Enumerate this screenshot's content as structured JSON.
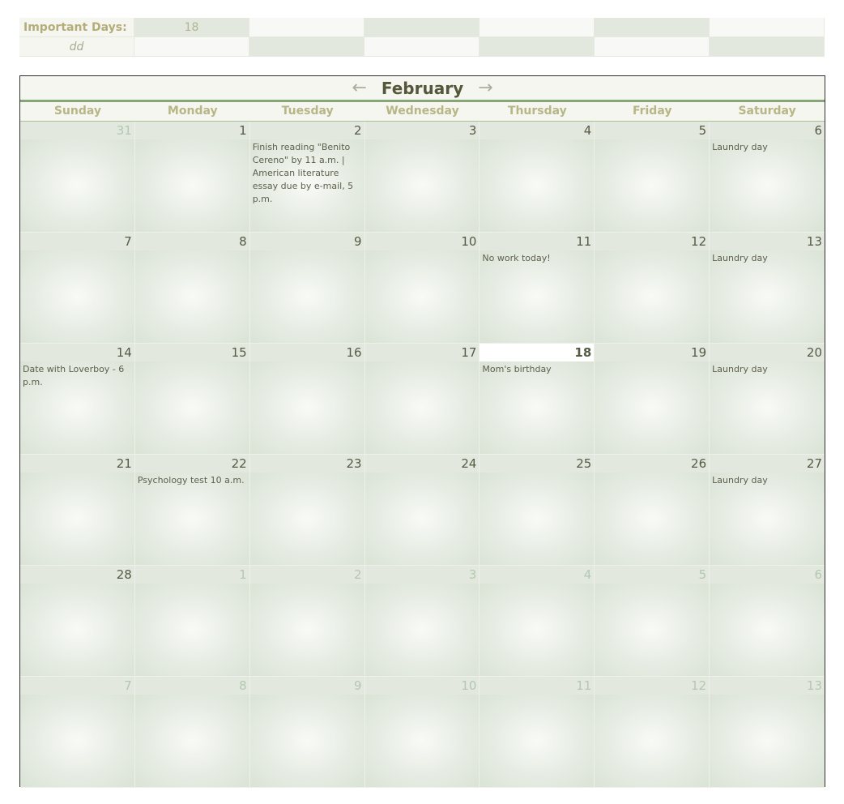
{
  "important_days": {
    "label": "Important Days:",
    "sub_label": "dd",
    "days": [
      "18",
      "",
      "",
      "",
      "",
      ""
    ]
  },
  "calendar": {
    "month": "February",
    "prev_icon": "left-arrow-icon",
    "next_icon": "right-arrow-icon",
    "prev_symbol": "←",
    "next_symbol": "→",
    "weekdays": [
      "Sunday",
      "Monday",
      "Tuesday",
      "Wednesday",
      "Thursday",
      "Friday",
      "Saturday"
    ],
    "cells": [
      {
        "day": "31",
        "other": true,
        "note": ""
      },
      {
        "day": "1",
        "note": ""
      },
      {
        "day": "2",
        "note": "Finish reading \"Benito Cereno\" by 11 a.m. | American literature essay due by e-mail, 5 p.m."
      },
      {
        "day": "3",
        "note": ""
      },
      {
        "day": "4",
        "note": ""
      },
      {
        "day": "5",
        "note": ""
      },
      {
        "day": "6",
        "note": "Laundry day"
      },
      {
        "day": "7",
        "note": ""
      },
      {
        "day": "8",
        "note": ""
      },
      {
        "day": "9",
        "note": ""
      },
      {
        "day": "10",
        "note": ""
      },
      {
        "day": "11",
        "note": "No work today!"
      },
      {
        "day": "12",
        "note": ""
      },
      {
        "day": "13",
        "note": "Laundry day"
      },
      {
        "day": "14",
        "note": "Date with Loverboy - 6 p.m."
      },
      {
        "day": "15",
        "note": ""
      },
      {
        "day": "16",
        "note": ""
      },
      {
        "day": "17",
        "note": ""
      },
      {
        "day": "18",
        "today": true,
        "note": "Mom's birthday"
      },
      {
        "day": "19",
        "note": ""
      },
      {
        "day": "20",
        "note": "Laundry day"
      },
      {
        "day": "21",
        "note": ""
      },
      {
        "day": "22",
        "note": "Psychology test 10 a.m."
      },
      {
        "day": "23",
        "note": ""
      },
      {
        "day": "24",
        "note": ""
      },
      {
        "day": "25",
        "note": ""
      },
      {
        "day": "26",
        "note": ""
      },
      {
        "day": "27",
        "note": "Laundry day"
      },
      {
        "day": "28",
        "note": ""
      },
      {
        "day": "1",
        "other": true,
        "note": ""
      },
      {
        "day": "2",
        "other": true,
        "note": ""
      },
      {
        "day": "3",
        "other": true,
        "note": ""
      },
      {
        "day": "4",
        "other": true,
        "note": ""
      },
      {
        "day": "5",
        "other": true,
        "note": ""
      },
      {
        "day": "6",
        "other": true,
        "note": ""
      },
      {
        "day": "7",
        "other": true,
        "note": ""
      },
      {
        "day": "8",
        "other": true,
        "note": ""
      },
      {
        "day": "9",
        "other": true,
        "note": ""
      },
      {
        "day": "10",
        "other": true,
        "note": ""
      },
      {
        "day": "11",
        "other": true,
        "note": ""
      },
      {
        "day": "12",
        "other": true,
        "note": ""
      },
      {
        "day": "13",
        "other": true,
        "note": ""
      }
    ]
  },
  "colors": {
    "header_green": "#86a677",
    "cell_header": "#e2e8dd",
    "weekday_text": "#b7b686",
    "other_month_text": "#b3c8b1"
  }
}
